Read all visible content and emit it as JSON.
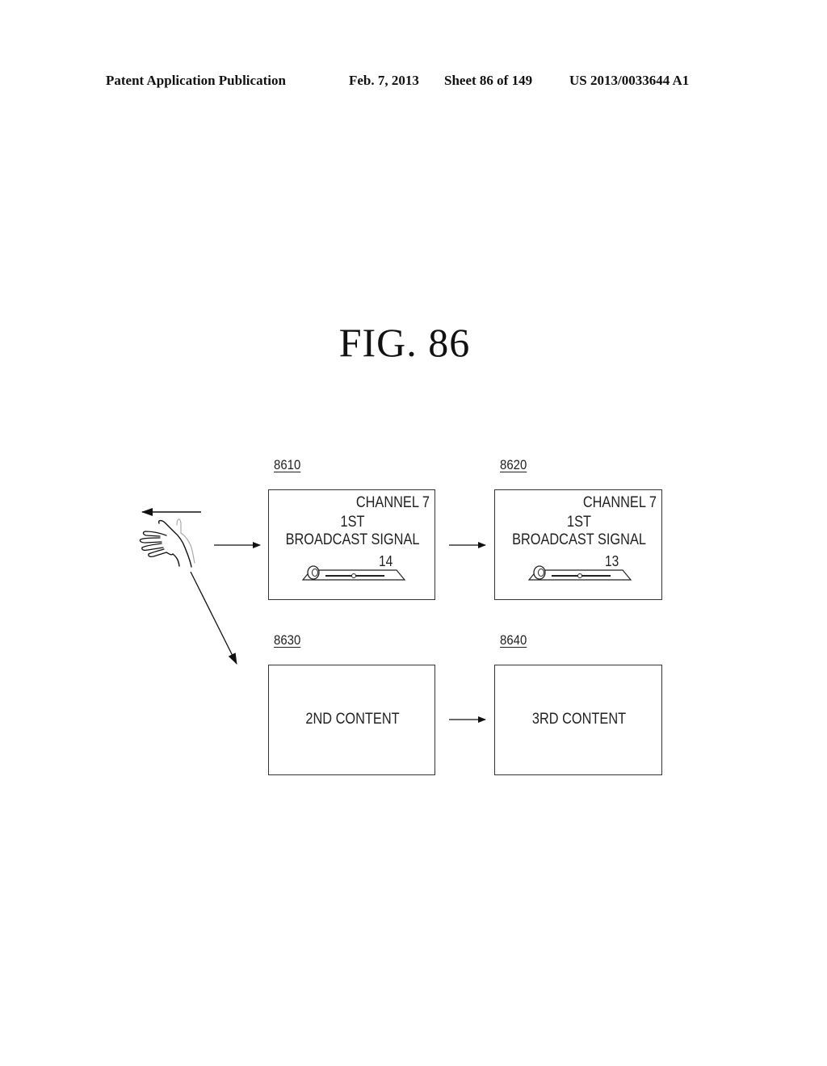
{
  "header": {
    "publication": "Patent Application Publication",
    "date": "Feb. 7, 2013",
    "sheet": "Sheet 86 of 149",
    "number": "US 2013/0033644 A1"
  },
  "figure": {
    "title": "FIG.  86"
  },
  "panels": [
    {
      "ref": "8610",
      "channel": "CHANNEL 7",
      "line1": "1ST",
      "line2": "BROADCAST SIGNAL",
      "volume": "14"
    },
    {
      "ref": "8620",
      "channel": "CHANNEL 7",
      "line1": "1ST",
      "line2": "BROADCAST SIGNAL",
      "volume": "13"
    },
    {
      "ref": "8630",
      "content": "2ND CONTENT"
    },
    {
      "ref": "8640",
      "content": "3RD CONTENT"
    }
  ],
  "gesture": {
    "icon": "hand-swipe-left-icon",
    "direction": "left"
  }
}
